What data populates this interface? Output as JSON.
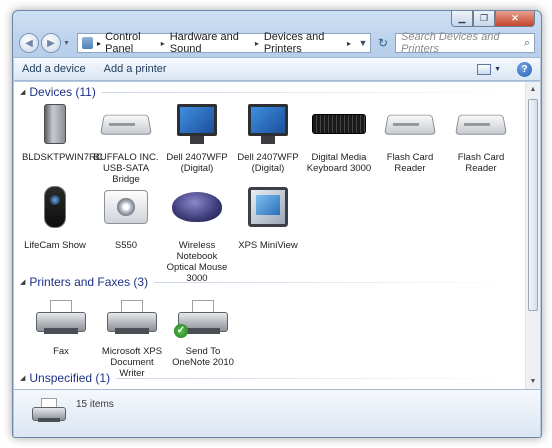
{
  "window": {
    "title": "Devices and Printers"
  },
  "caption": {
    "min": "▁",
    "max": "❐",
    "close": "✕"
  },
  "nav": {
    "back_glyph": "◀",
    "forward_glyph": "▶",
    "breadcrumb": [
      "Control Panel",
      "Hardware and Sound",
      "Devices and Printers"
    ],
    "search_placeholder": "Search Devices and Printers"
  },
  "toolbar": {
    "add_device": "Add a device",
    "add_printer": "Add a printer",
    "help": "?"
  },
  "groups": {
    "devices": {
      "label": "Devices (11)"
    },
    "printers": {
      "label": "Printers and Faxes (3)"
    },
    "unspecified": {
      "label": "Unspecified (1)"
    }
  },
  "devices": [
    {
      "name": "BLDSKTPWIN7RC",
      "icon": "computer-tower-icon"
    },
    {
      "name": "BUFFALO INC. USB-SATA Bridge",
      "icon": "external-drive-icon"
    },
    {
      "name": "Dell 2407WFP (Digital)",
      "icon": "monitor-icon"
    },
    {
      "name": "Dell 2407WFP (Digital)",
      "icon": "monitor-icon"
    },
    {
      "name": "Digital Media Keyboard 3000",
      "icon": "keyboard-icon"
    },
    {
      "name": "Flash Card Reader",
      "icon": "card-reader-icon"
    },
    {
      "name": "Flash Card Reader",
      "icon": "card-reader-icon"
    },
    {
      "name": "LifeCam Show",
      "icon": "webcam-icon"
    },
    {
      "name": "S550",
      "icon": "camera-icon"
    },
    {
      "name": "Wireless Notebook Optical Mouse 3000",
      "icon": "mouse-icon"
    },
    {
      "name": "XPS MiniView",
      "icon": "display-icon"
    }
  ],
  "printers": [
    {
      "name": "Fax",
      "icon": "fax-icon"
    },
    {
      "name": "Microsoft XPS Document Writer",
      "icon": "printer-icon"
    },
    {
      "name": "Send To OneNote 2010",
      "icon": "printer-default-icon"
    }
  ],
  "status": {
    "item_count": "15 items"
  },
  "colors": {
    "group_header": "#1e3287",
    "frame": "#b3cbe7"
  }
}
